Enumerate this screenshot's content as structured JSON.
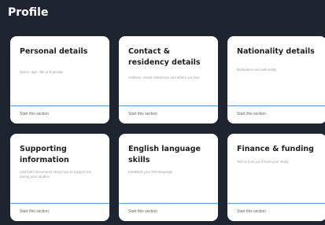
{
  "page": {
    "title": "Profile"
  },
  "cards": [
    {
      "title": "Personal details",
      "description": "Name, age, title and gender",
      "action": "Start this section"
    },
    {
      "title": "Contact & residency details",
      "description": "Address, email, telephone and where you live",
      "action": "Start this section"
    },
    {
      "title": "Nationality details",
      "description": "Birthplace and nationality",
      "action": "Start this section"
    },
    {
      "title": "Supporting information",
      "description": "Add both documents show how to support me during your studies",
      "action": "Start this section"
    },
    {
      "title": "English language skills",
      "description": "Establish your first language",
      "action": "Start this section"
    },
    {
      "title": "Finance & funding",
      "description": "Tell us how you'll fund your study",
      "action": "Start this section"
    }
  ]
}
